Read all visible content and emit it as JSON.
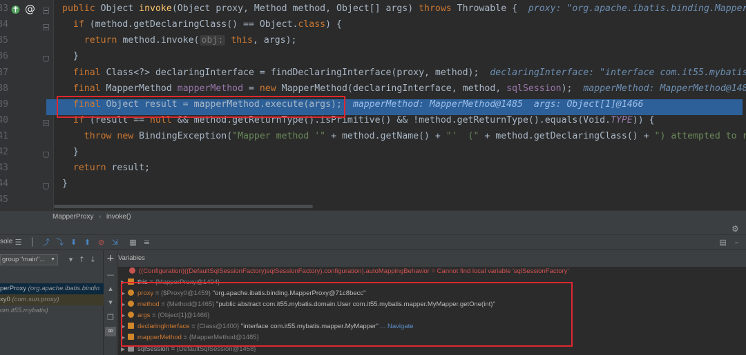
{
  "editor": {
    "line_numbers": [
      "33",
      "34",
      "35",
      "36",
      "37",
      "38",
      "39",
      "40",
      "41",
      "42",
      "43",
      "44",
      "45",
      "46"
    ],
    "code": {
      "l1": {
        "a": "public",
        "b": " Object ",
        "c": "invoke",
        "d": "(Object proxy, Method method, Object[] args) ",
        "e": "throws",
        "f": " Throwable {  ",
        "g": "proxy: \"org.apache.ibatis.binding.MapperF"
      },
      "l2": {
        "a": "  if ",
        "b": "(method.getDeclaringClass() == Object.",
        "c": "class",
        "d": ") {"
      },
      "l3": {
        "a": "    return ",
        "b": "method.invoke(",
        "hint": "obj:",
        "c": " this",
        "d": ", args);"
      },
      "l4": "  }",
      "l5": {
        "a": "  final ",
        "b": "Class<?> declaringInterface = findDeclaringInterface(proxy, method);  ",
        "c": "declaringInterface: \"interface com.it55.mybatis.m"
      },
      "l6": {
        "a": "  final ",
        "b": "MapperMethod ",
        "c": "mapperMethod",
        "d": " = ",
        "e": "new ",
        "f": "MapperMethod(declaringInterface, method, ",
        "g": "sqlSession",
        "h": ");  ",
        "i": "mapperMethod: MapperMethod@1485"
      },
      "l7": {
        "a": "  final ",
        "b": "Object result = mapperMethod.execute(args);  ",
        "c": "mapperMethod: MapperMethod@1485  args: Object[1]@1466"
      },
      "l8": {
        "a": "  if ",
        "b": "(result == ",
        "c": "null",
        "d": " && method.getReturnType().isPrimitive() && !method.getReturnType().equals(Void.",
        "e": "TYPE",
        "f": ")) {"
      },
      "l9": {
        "a": "    throw new ",
        "b": "BindingException(",
        "c": "\"Mapper method '\"",
        "d": " + method.getName() + ",
        "e": "\"'  (\"",
        "f": " + method.getDeclaringClass() + ",
        "g": "\") attempted to retu"
      },
      "l10": "  }",
      "l11": {
        "a": "  return ",
        "b": "result;"
      },
      "l12": "}"
    }
  },
  "breadcrumb": {
    "class": "MapperProxy",
    "sep": "›",
    "method": "invoke()"
  },
  "debug": {
    "toolbar_label": "sole",
    "gear_icon": "gear-icon",
    "frames": {
      "thread_selector": "group \"main\"...",
      "rows": [
        {
          "a": "perProxy",
          "b": " (org.apache.ibatis.bindin"
        },
        {
          "a": "xy0",
          "b": " (com.sun.proxy)"
        },
        {
          "a": "om.it55.mybatis)",
          "b": ""
        }
      ]
    },
    "variables_title": "Variables",
    "variables": [
      {
        "kind": "err",
        "text": "((Configuration)((DefaultSqlSessionFactory)sqlSessionFactory).configuration).autoMappingBehavior",
        "eq": " = ",
        "value": "Cannot find local variable 'sqlSessionFactory'"
      },
      {
        "kind": "list",
        "name": "this",
        "eq": " = ",
        "type": "{MapperProxy@1404}"
      },
      {
        "kind": "obj",
        "name": "proxy",
        "eq": " = ",
        "type": "{$Proxy0@1459} ",
        "value": "\"org.apache.ibatis.binding.MapperProxy@71c8becc\""
      },
      {
        "kind": "obj",
        "name": "method",
        "eq": " = ",
        "type": "{Method@1465} ",
        "value": "\"public abstract com.it55.mybatis.domain.User com.it55.mybatis.mapper.MyMapper.getOne(int)\""
      },
      {
        "kind": "obj",
        "name": "args",
        "eq": " = ",
        "type": "{Object[1]@1466}"
      },
      {
        "kind": "obj",
        "name": "declaringInterface",
        "eq": " = ",
        "type": "{Class@1400} ",
        "value": "\"interface com.it55.mybatis.mapper.MyMapper\"",
        "nav": " ... Navigate"
      },
      {
        "kind": "list",
        "name": "mapperMethod",
        "eq": " = ",
        "type": "{MapperMethod@1485}"
      },
      {
        "kind": "obj",
        "name": "sqlSession",
        "eq": " = ",
        "type": "{DefaultSqlSession@1458}"
      }
    ]
  },
  "colors": {
    "highlight": "#2d6099",
    "annotation": "#e0272f"
  }
}
